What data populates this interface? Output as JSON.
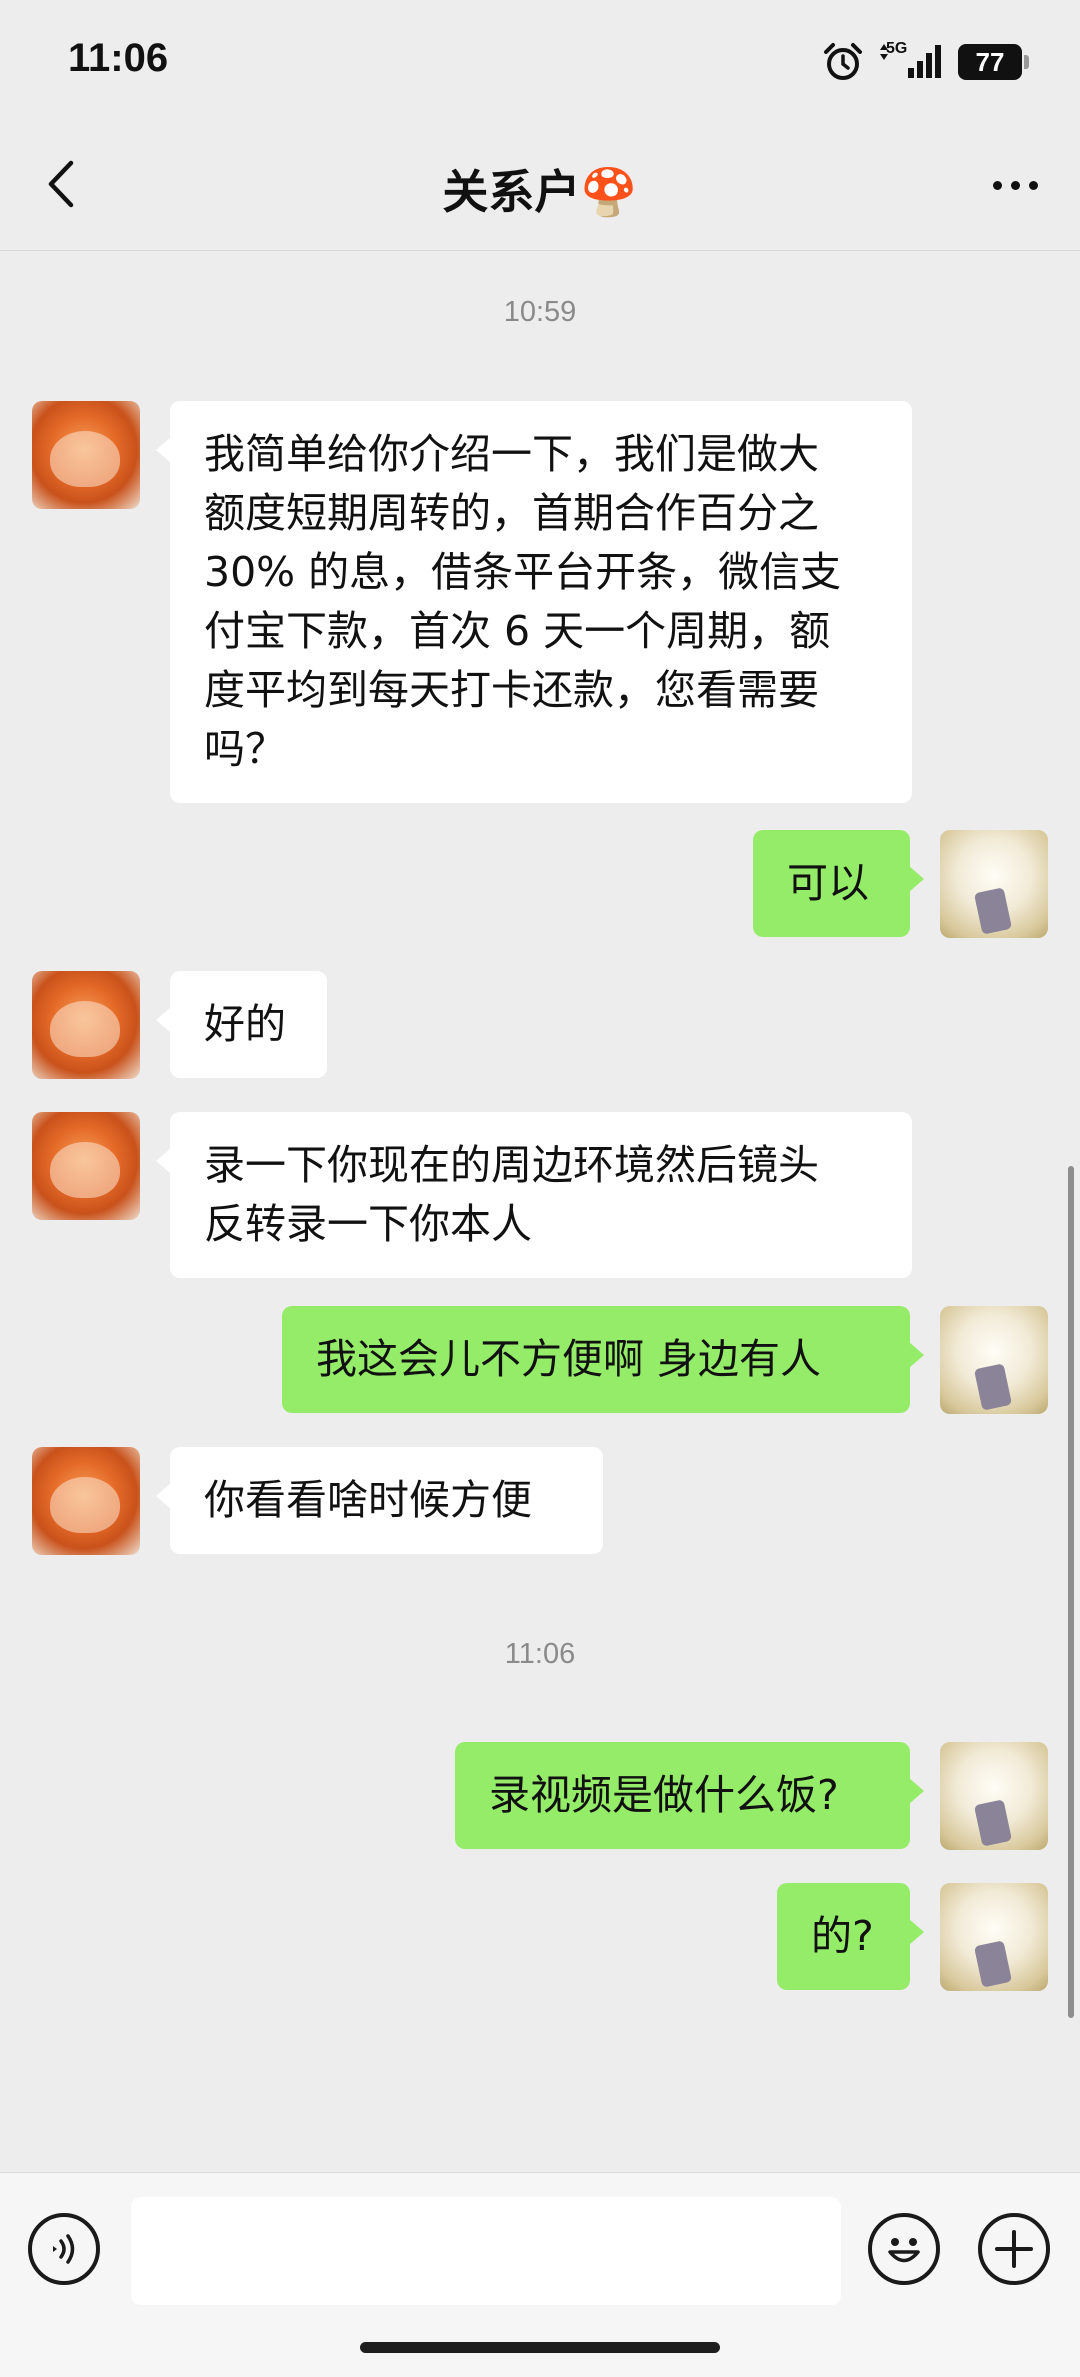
{
  "status_bar": {
    "time": "11:06",
    "network": "5G",
    "battery": "77",
    "icons": [
      "alarm-icon",
      "signal-icon",
      "battery-icon"
    ]
  },
  "header": {
    "title": "关系户🍄",
    "back_icon": "chevron-left-icon",
    "more_icon": "more-dots-icon"
  },
  "messages": [
    {
      "type": "time",
      "text": "10:59"
    },
    {
      "type": "msg",
      "side": "left",
      "lines": [
        "我简单给你介绍一下，我们是做大",
        "额度短期周转的，首期合作百分之",
        "30% 的息，借条平台开条，微信支",
        "付宝下款，首次 6 天一个周期，额",
        "度平均到每天打卡还款，您看需要",
        "吗？"
      ]
    },
    {
      "type": "msg",
      "side": "right",
      "lines": [
        "可以"
      ]
    },
    {
      "type": "msg",
      "side": "left",
      "lines": [
        "好的"
      ]
    },
    {
      "type": "msg",
      "side": "left",
      "lines": [
        "录一下你现在的周边环境然后镜头",
        "反转录一下你本人"
      ]
    },
    {
      "type": "msg",
      "side": "right",
      "lines": [
        "我这会儿不方便啊 身边有人"
      ]
    },
    {
      "type": "msg",
      "side": "left",
      "lines": [
        "你看看啥时候方便"
      ]
    },
    {
      "type": "time",
      "text": "11:06"
    },
    {
      "type": "msg",
      "side": "right",
      "lines": [
        "录视频是做什么饭?"
      ]
    },
    {
      "type": "msg",
      "side": "right",
      "lines": [
        "的?"
      ]
    }
  ],
  "input_bar": {
    "placeholder": "",
    "voice_icon": "voice-icon",
    "emoji_icon": "emoji-icon",
    "plus_icon": "plus-icon"
  },
  "colors": {
    "background": "#ededed",
    "bubble_self": "#95ec69",
    "bubble_other": "#ffffff",
    "timestamp": "#8a8a8a"
  }
}
